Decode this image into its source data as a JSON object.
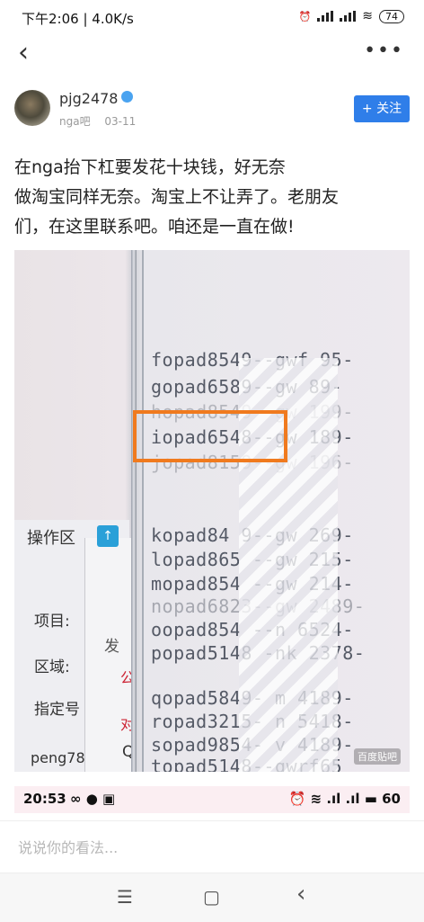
{
  "status_bar": {
    "time_speed": "下午2:06 | 4.0K/s",
    "alarm_icon": "alarm-icon",
    "battery": "74"
  },
  "nav": {
    "back_icon": "chevron-left-icon",
    "more_icon": "more-icon"
  },
  "author": {
    "name": "pjg2478",
    "source": "nga吧",
    "date": "03-11",
    "follow_label": "+ 关注"
  },
  "post": {
    "text_line1": "在nga抬下杠要发花十块钱，好无奈",
    "text_line2": "做淘宝同样无奈。淘宝上不让弄了。老朋友",
    "text_line3": "们，在这里联系吧。咱还是一直在做!"
  },
  "photo": {
    "left_tab": "操作区",
    "left_labels": [
      "项目:",
      "区域:",
      "指定号"
    ],
    "left_bottom": "peng78",
    "red_chars": [
      "公",
      "对"
    ],
    "side_chars": [
      "发",
      "Q"
    ],
    "lines": [
      "fopad8549--gwf  95-",
      "gopad6589--gw   89-",
      "hopad8549--gw  199-",
      "iopad6548--gw  189-",
      "jopad8159--gw  196-",
      "kopad84 9--gw  269-",
      "lopad865 --gw  215-",
      "mopad854 --gw  214-",
      "nopad6823--gw 2489-",
      "oopad854 --n  6524-",
      "popad5148 -nk 2378-",
      "qopad5849- m  4189-",
      "ropad3215- n  5418-",
      "sopad9854- v  4189-",
      "topad5148--gwrf65"
    ],
    "watermark": "百度贴吧"
  },
  "phone_status": {
    "time": "20:53",
    "battery": "60"
  },
  "comment": {
    "placeholder": "说说你的看法..."
  },
  "system_nav": {
    "menu": "☰",
    "home": "▢",
    "back": "‹"
  }
}
